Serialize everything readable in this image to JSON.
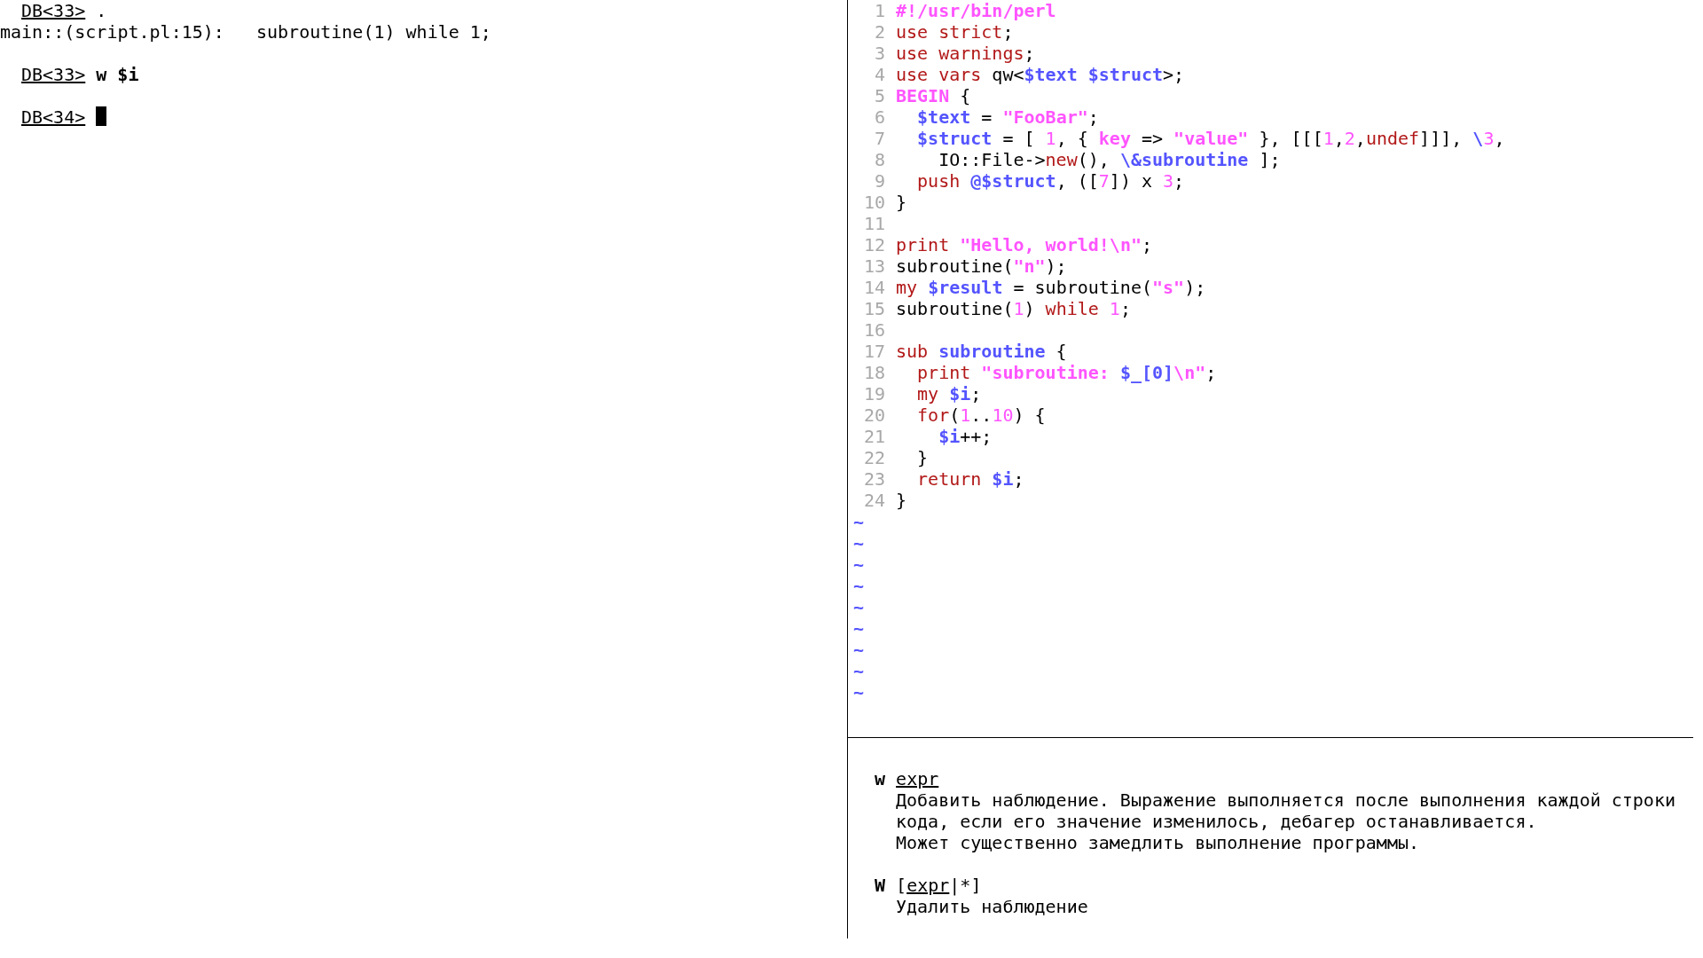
{
  "terminal": {
    "lines": [
      {
        "tokens": [
          {
            "text": "DB<33>",
            "kind": "prompt"
          },
          {
            "text": " ."
          }
        ]
      },
      {
        "tokens": [
          {
            "text": "main::(script.pl:15):   subroutine(1) while 1;"
          }
        ]
      },
      {
        "spaced": true,
        "tokens": [
          {
            "text": "DB<33>",
            "kind": "prompt"
          },
          {
            "text": " w $i",
            "kind": "input"
          }
        ]
      },
      {
        "spaced": true,
        "tokens": [
          {
            "text": "DB<34>",
            "kind": "prompt"
          },
          {
            "kind": "cursor"
          }
        ]
      }
    ]
  },
  "editor": {
    "lines": [
      {
        "number": "1",
        "tokens": [
          {
            "text": "#!/usr/bin/perl",
            "kind": "comment"
          }
        ]
      },
      {
        "number": "2",
        "tokens": [
          {
            "text": "use strict",
            "kind": "keyword"
          },
          {
            "text": ";"
          }
        ]
      },
      {
        "number": "3",
        "tokens": [
          {
            "text": "use warnings",
            "kind": "keyword"
          },
          {
            "text": ";"
          }
        ]
      },
      {
        "number": "4",
        "tokens": [
          {
            "text": "use vars",
            "kind": "keyword"
          },
          {
            "text": " qw<"
          },
          {
            "text": "$text $struct",
            "kind": "variable"
          },
          {
            "text": ">;"
          }
        ]
      },
      {
        "number": "5",
        "tokens": [
          {
            "text": "BEGIN",
            "kind": "comment"
          },
          {
            "text": " {"
          }
        ]
      },
      {
        "number": "6",
        "tokens": [
          {
            "text": "  $text",
            "kind": "variable"
          },
          {
            "text": " = "
          },
          {
            "text": "\"FooBar\"",
            "kind": "string"
          },
          {
            "text": ";"
          }
        ]
      },
      {
        "number": "7",
        "tokens": [
          {
            "text": "  $struct",
            "kind": "variable"
          },
          {
            "text": " = [ "
          },
          {
            "text": "1",
            "kind": "number"
          },
          {
            "text": ", { "
          },
          {
            "text": "key",
            "kind": "string"
          },
          {
            "text": " => "
          },
          {
            "text": "\"value\"",
            "kind": "string"
          },
          {
            "text": " }, [[["
          },
          {
            "text": "1",
            "kind": "number"
          },
          {
            "text": ","
          },
          {
            "text": "2",
            "kind": "number"
          },
          {
            "text": ","
          },
          {
            "text": "undef",
            "kind": "keyword"
          },
          {
            "text": "]]], "
          },
          {
            "text": "\\",
            "kind": "variable"
          },
          {
            "text": "3",
            "kind": "number"
          },
          {
            "text": ","
          }
        ]
      },
      {
        "number": "8",
        "tokens": [
          {
            "text": "    IO::File->"
          },
          {
            "text": "new",
            "kind": "keyword"
          },
          {
            "text": "(), "
          },
          {
            "text": "\\&subroutine",
            "kind": "variable"
          },
          {
            "text": " ];"
          }
        ]
      },
      {
        "number": "9",
        "tokens": [
          {
            "text": "  push",
            "kind": "keyword"
          },
          {
            "text": " @$struct",
            "kind": "variable"
          },
          {
            "text": ", (["
          },
          {
            "text": "7",
            "kind": "number"
          },
          {
            "text": "]) x "
          },
          {
            "text": "3",
            "kind": "number"
          },
          {
            "text": ";"
          }
        ]
      },
      {
        "number": "10",
        "tokens": [
          {
            "text": "}"
          }
        ]
      },
      {
        "number": "11"
      },
      {
        "number": "12",
        "tokens": [
          {
            "text": "print",
            "kind": "keyword"
          },
          {
            "text": " \"Hello, world!\\n\"",
            "kind": "string"
          },
          {
            "text": ";"
          }
        ]
      },
      {
        "number": "13",
        "tokens": [
          {
            "text": "subroutine("
          },
          {
            "text": "\"n\"",
            "kind": "string"
          },
          {
            "text": ");"
          }
        ]
      },
      {
        "number": "14",
        "tokens": [
          {
            "text": "my",
            "kind": "keyword"
          },
          {
            "text": " $result",
            "kind": "variable"
          },
          {
            "text": " = subroutine("
          },
          {
            "text": "\"s\"",
            "kind": "string"
          },
          {
            "text": ");"
          }
        ]
      },
      {
        "number": "15",
        "tokens": [
          {
            "text": "subroutine("
          },
          {
            "text": "1",
            "kind": "number"
          },
          {
            "text": ") "
          },
          {
            "text": "while",
            "kind": "keyword"
          },
          {
            "text": " 1",
            "kind": "number"
          },
          {
            "text": ";"
          }
        ]
      },
      {
        "number": "16"
      },
      {
        "number": "17",
        "tokens": [
          {
            "text": "sub",
            "kind": "keyword"
          },
          {
            "text": " subroutine",
            "kind": "variable"
          },
          {
            "text": " {"
          }
        ]
      },
      {
        "number": "18",
        "tokens": [
          {
            "text": "  print",
            "kind": "keyword"
          },
          {
            "text": " \"subroutine: ",
            "kind": "string"
          },
          {
            "text": "$_[0]",
            "kind": "variable"
          },
          {
            "text": "\\n\"",
            "kind": "string"
          },
          {
            "text": ";"
          }
        ]
      },
      {
        "number": "19",
        "tokens": [
          {
            "text": "  my",
            "kind": "keyword"
          },
          {
            "text": " $i",
            "kind": "variable"
          },
          {
            "text": ";"
          }
        ]
      },
      {
        "number": "20",
        "tokens": [
          {
            "text": "  for",
            "kind": "keyword"
          },
          {
            "text": "("
          },
          {
            "text": "1",
            "kind": "number"
          },
          {
            "text": ".."
          },
          {
            "text": "10",
            "kind": "number"
          },
          {
            "text": ") {"
          }
        ]
      },
      {
        "number": "21",
        "tokens": [
          {
            "text": "    $i",
            "kind": "variable"
          },
          {
            "text": "++;"
          }
        ]
      },
      {
        "number": "22",
        "tokens": [
          {
            "text": "  }"
          }
        ]
      },
      {
        "number": "23",
        "tokens": [
          {
            "text": "  return",
            "kind": "keyword"
          },
          {
            "text": " $i",
            "kind": "variable"
          },
          {
            "text": ";"
          }
        ]
      },
      {
        "number": "24",
        "tokens": [
          {
            "text": "}"
          }
        ]
      }
    ],
    "filler": [
      "~",
      "~",
      "~",
      "~",
      "~",
      "~",
      "~",
      "~",
      "~"
    ]
  },
  "help": [
    {
      "command": [
        {
          "text": "w ",
          "kind": "bold"
        },
        {
          "text": "expr",
          "kind": "underline"
        }
      ],
      "description": [
        "Добавить наблюдение. Выражение выполняется после выполнения каждой строки",
        "кода, если его значение изменилось, дебагер останавливается.",
        "Может существенно замедлить выполнение программы."
      ]
    },
    {
      "command": [
        {
          "text": "W",
          "kind": "bold"
        },
        {
          "text": " ["
        },
        {
          "text": "expr",
          "kind": "underline"
        },
        {
          "text": "|*]"
        }
      ],
      "description": [
        "Удалить наблюдение"
      ]
    }
  ]
}
